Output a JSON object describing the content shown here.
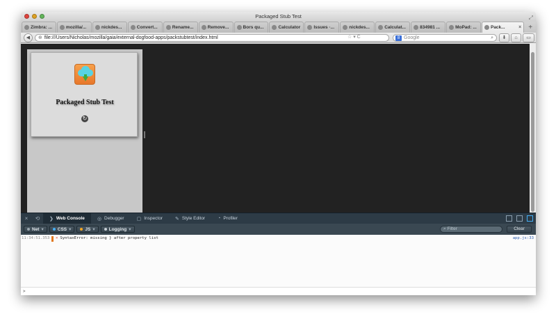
{
  "window": {
    "title": "Packaged Stub Test"
  },
  "tabs": [
    {
      "label": "Zimbra: ...",
      "icon": "zimbra-icon"
    },
    {
      "label": "mozilla/...",
      "icon": "github-icon"
    },
    {
      "label": "nickdes...",
      "icon": "github-icon"
    },
    {
      "label": "Convert...",
      "icon": "github-icon"
    },
    {
      "label": "Rename...",
      "icon": "github-icon"
    },
    {
      "label": "Remove...",
      "icon": "github-icon"
    },
    {
      "label": "Bors qu...",
      "icon": "bors-icon"
    },
    {
      "label": "Calculator",
      "icon": "page-icon"
    },
    {
      "label": "Issues ·...",
      "icon": "github-icon"
    },
    {
      "label": "nickdes...",
      "icon": "github-icon"
    },
    {
      "label": "Calculat...",
      "icon": "app-icon"
    },
    {
      "label": "834981 ...",
      "icon": "bugzilla-icon"
    },
    {
      "label": "MoPad: ...",
      "icon": "etherpad-icon"
    },
    {
      "label": "Pack...",
      "icon": "page-icon",
      "active": true
    }
  ],
  "nav": {
    "url": "file:///Users/Nicholas/mozilla/gaia/external-dogfood-apps/packstubtest/index.html",
    "search_placeholder": "Google"
  },
  "app": {
    "title": "Packaged Stub Test"
  },
  "devtools": {
    "tabs": [
      {
        "label": "Web Console",
        "icon": "console-icon",
        "active": true
      },
      {
        "label": "Debugger",
        "icon": "debugger-icon"
      },
      {
        "label": "Inspector",
        "icon": "inspector-icon"
      },
      {
        "label": "Style Editor",
        "icon": "style-editor-icon"
      },
      {
        "label": "Profiler",
        "icon": "profiler-icon"
      }
    ],
    "filters": [
      {
        "label": "Net",
        "dot": "#9aa6ae"
      },
      {
        "label": "CSS",
        "dot": "#46aff6"
      },
      {
        "label": "JS",
        "dot": "#f5a623"
      },
      {
        "label": "Logging",
        "dot": "#c8d0d6"
      }
    ],
    "filter_placeholder": "Filter",
    "clear_label": "Clear"
  },
  "console": {
    "entries": [
      {
        "time": "11:34:51.353",
        "message": "SyntaxError: missing } after property list",
        "source": "app.js:33"
      }
    ],
    "prompt": ">"
  }
}
